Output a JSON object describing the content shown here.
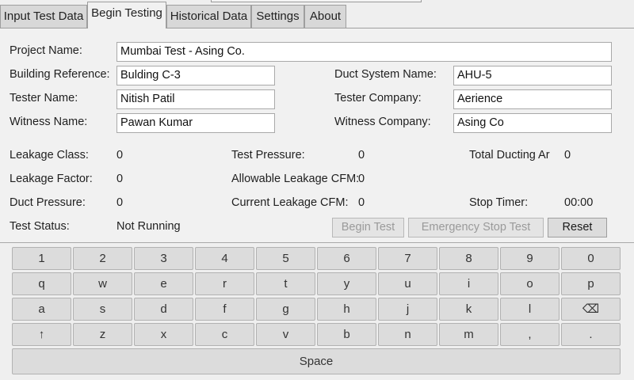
{
  "tabs": [
    {
      "label": "Input Test Data"
    },
    {
      "label": "Begin Testing"
    },
    {
      "label": "Historical Data"
    },
    {
      "label": "Settings"
    },
    {
      "label": "About"
    }
  ],
  "form": {
    "project_name_label": "Project Name:",
    "project_name_value": "Mumbai Test - Asing Co.",
    "building_ref_label": "Building Reference:",
    "building_ref_value": "Bulding C-3",
    "duct_system_label": "Duct System Name:",
    "duct_system_value": "AHU-5",
    "tester_name_label": "Tester Name:",
    "tester_name_value": "Nitish Patil",
    "tester_company_label": "Tester Company:",
    "tester_company_value": "Aerience",
    "witness_name_label": "Witness Name:",
    "witness_name_value": "Pawan Kumar",
    "witness_company_label": "Witness Company:",
    "witness_company_value": "Asing Co"
  },
  "stats": {
    "leakage_class_label": "Leakage Class:",
    "leakage_class_value": "0",
    "test_pressure_label": "Test Pressure:",
    "test_pressure_value": "0",
    "total_ducting_label": "Total Ducting Are",
    "total_ducting_value": "0",
    "leakage_factor_label": "Leakage Factor:",
    "leakage_factor_value": "0",
    "allowable_leakage_label": "Allowable Leakage CFM:",
    "allowable_leakage_value": "0",
    "duct_pressure_label": "Duct Pressure:",
    "duct_pressure_value": "0",
    "current_leakage_label": "Current Leakage CFM:",
    "current_leakage_value": "0",
    "stop_timer_label": "Stop Timer:",
    "stop_timer_value": "00:00",
    "test_status_label": "Test Status:",
    "test_status_value": "Not Running"
  },
  "actions": {
    "begin_test": "Begin Test",
    "emergency_stop": "Emergency Stop Test",
    "reset": "Reset"
  },
  "keyboard": {
    "row1": [
      "1",
      "2",
      "3",
      "4",
      "5",
      "6",
      "7",
      "8",
      "9",
      "0"
    ],
    "row2": [
      "q",
      "w",
      "e",
      "r",
      "t",
      "y",
      "u",
      "i",
      "o",
      "p"
    ],
    "row3": [
      "a",
      "s",
      "d",
      "f",
      "g",
      "h",
      "j",
      "k",
      "l",
      "⌫"
    ],
    "row4": [
      "↑",
      "z",
      "x",
      "c",
      "v",
      "b",
      "n",
      "m",
      ",",
      "."
    ],
    "space": "Space"
  }
}
